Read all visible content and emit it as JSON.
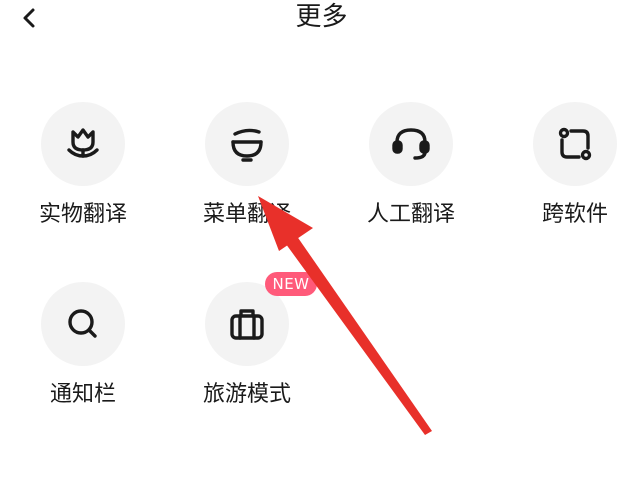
{
  "header": {
    "title": "更多",
    "back_icon": "chevron-left-icon"
  },
  "tiles": [
    {
      "label": "实物翻译",
      "icon": "tulip-icon"
    },
    {
      "label": "菜单翻译",
      "icon": "noodle-bowl-icon"
    },
    {
      "label": "人工翻译",
      "icon": "headset-icon"
    },
    {
      "label": "跨软件",
      "icon": "cross-app-icon"
    },
    {
      "label": "通知栏",
      "icon": "search-icon"
    },
    {
      "label": "旅游模式",
      "icon": "suitcase-icon"
    }
  ],
  "badge": {
    "text": "NEW",
    "color": "#ff5a7a"
  },
  "annotation": {
    "arrow_color": "#e8302a"
  }
}
